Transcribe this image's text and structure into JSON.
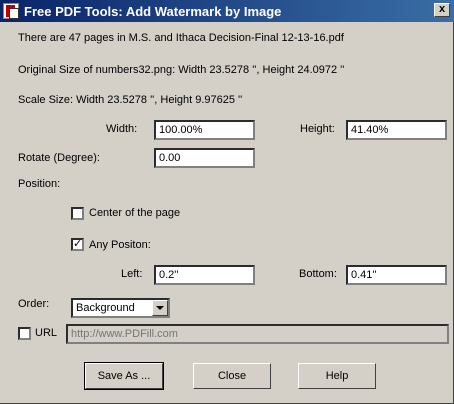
{
  "window": {
    "title": "Free PDF Tools: Add Watermark by Image",
    "close_glyph": "x"
  },
  "info": {
    "pages_line": "There are 47 pages in M.S. and Ithaca Decision-Final 12-13-16.pdf",
    "original_size_line": "Original Size of numbers32.png:  Width 23.5278 '',    Height 24.0972 ''",
    "scale_size_line": "Scale Size:  Width 23.5278 '',    Height 9.97625 ''"
  },
  "form": {
    "width_label": "Width:",
    "width_value": "100.00%",
    "height_label": "Height:",
    "height_value": "41.40%",
    "rotate_label": "Rotate (Degree):",
    "rotate_value": "0.00",
    "position_label": "Position:",
    "center_label": "Center of the page",
    "center_checked": false,
    "any_label": "Any Positon:",
    "any_checked": true,
    "left_label": "Left:",
    "left_value": "0.2''",
    "bottom_label": "Bottom:",
    "bottom_value": "0.41''",
    "order_label": "Order:",
    "order_value": "Background",
    "url_label": "URL",
    "url_checked": false,
    "url_placeholder": "http://www.PDFill.com"
  },
  "buttons": {
    "save_as": "Save As ...",
    "close": "Close",
    "help": "Help"
  }
}
